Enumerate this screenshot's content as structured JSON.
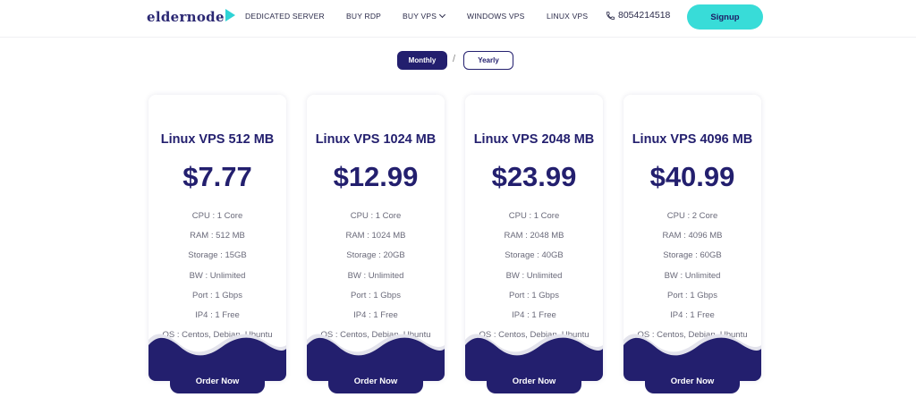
{
  "brand": {
    "logo_text": "eldernode"
  },
  "nav": {
    "items": [
      "DEDICATED SERVER",
      "BUY RDP",
      "BUY VPS",
      "WINDOWS VPS",
      "LINUX VPS"
    ],
    "phone": "8054214518",
    "signup_label": "Signup"
  },
  "billing": {
    "monthly_label": "Monthly",
    "separator": "/",
    "yearly_label": "Yearly"
  },
  "plans": [
    {
      "name": "Linux VPS 512 MB",
      "price": "$7.77",
      "specs": [
        "CPU : 1 Core",
        "RAM : 512 MB",
        "Storage : 15GB",
        "BW : Unlimited",
        "Port : 1 Gbps",
        "IP4 : 1 Free",
        "OS : Centos, Debian, Ubuntu"
      ],
      "order_label": "Order Now"
    },
    {
      "name": "Linux VPS 1024 MB",
      "price": "$12.99",
      "specs": [
        "CPU : 1 Core",
        "RAM : 1024 MB",
        "Storage : 20GB",
        "BW : Unlimited",
        "Port : 1 Gbps",
        "IP4 : 1 Free",
        "OS : Centos, Debian, Ubuntu"
      ],
      "order_label": "Order Now"
    },
    {
      "name": "Linux VPS 2048 MB",
      "price": "$23.99",
      "specs": [
        "CPU : 1 Core",
        "RAM : 2048 MB",
        "Storage : 40GB",
        "BW : Unlimited",
        "Port : 1 Gbps",
        "IP4 : 1 Free",
        "OS : Centos, Debian, Ubuntu"
      ],
      "order_label": "Order Now"
    },
    {
      "name": "Linux VPS 4096 MB",
      "price": "$40.99",
      "specs": [
        "CPU : 2 Core",
        "RAM : 4096 MB",
        "Storage : 60GB",
        "BW : Unlimited",
        "Port : 1 Gbps",
        "IP4 : 1 Free",
        "OS : Centos, Debian, Ubuntu"
      ],
      "order_label": "Order Now"
    }
  ],
  "colors": {
    "brand_navy": "#231f6e",
    "accent_teal": "#38dcd8",
    "text_muted": "#6a6a7a"
  },
  "icons": {
    "phone": "phone-icon",
    "logo_mark": "play-triangle-icon",
    "dropdown": "chevron-down-icon"
  }
}
